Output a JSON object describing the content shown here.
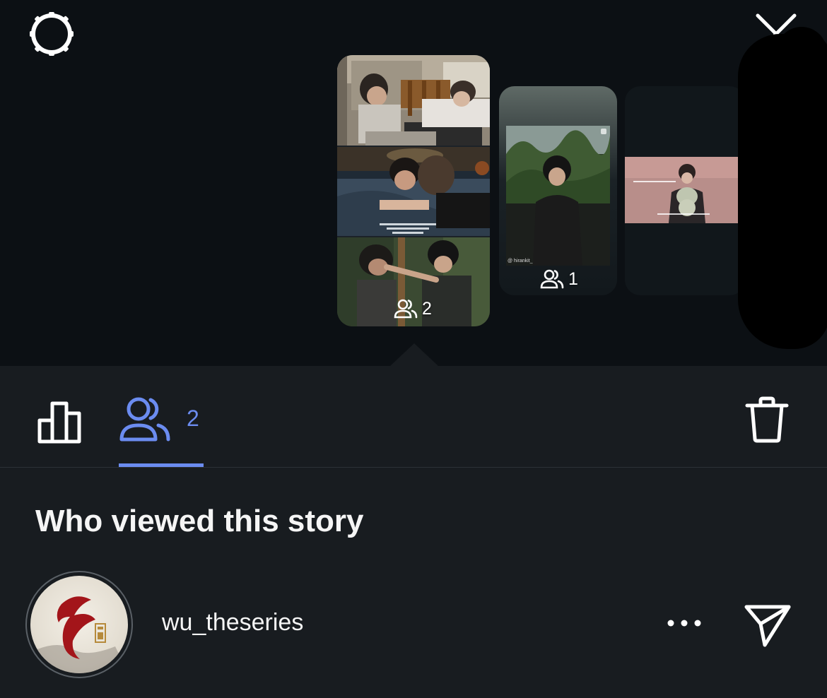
{
  "header": {
    "settings_icon": "gear-icon",
    "close_icon": "close-icon"
  },
  "stories": [
    {
      "viewer_count": "2",
      "selected": true
    },
    {
      "viewer_count": "1",
      "selected": false,
      "caption": "@ hirankit_"
    },
    {
      "viewer_count": "",
      "selected": false
    }
  ],
  "tabs": {
    "insights_icon": "bar-chart-icon",
    "viewers_icon": "people-icon",
    "viewers_count": "2",
    "active_color": "#6b8cf0",
    "delete_icon": "trash-icon"
  },
  "section": {
    "title": "Who viewed this story"
  },
  "viewers": [
    {
      "username": "wu_theseries",
      "avatar_glyph": "ฮู",
      "more_icon": "more-icon",
      "send_icon": "send-icon"
    }
  ],
  "colors": {
    "background": "#0c1014",
    "panel": "#181c20",
    "accent": "#6b8cf0",
    "text": "#f5f5f5"
  }
}
